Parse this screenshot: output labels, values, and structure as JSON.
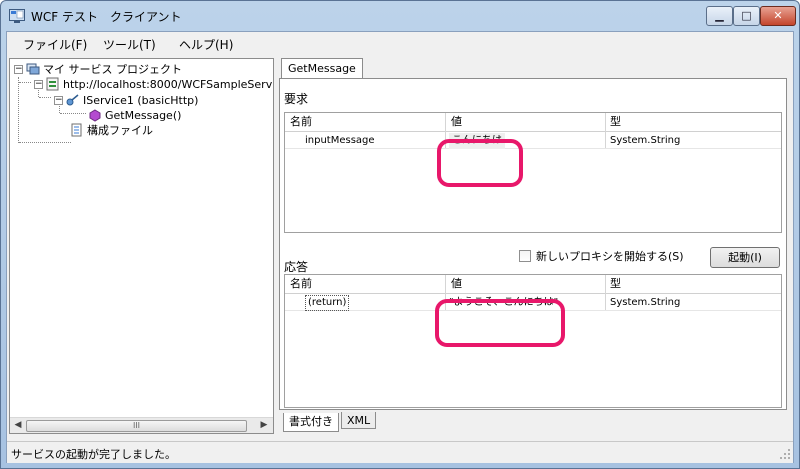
{
  "window": {
    "title": "WCF テスト　クライアント",
    "controls": {
      "minimize": "▁",
      "maximize": "□",
      "close": "✕"
    }
  },
  "menu": [
    {
      "label": "ファイル(F)"
    },
    {
      "label": "ツール(T)"
    },
    {
      "label": "ヘルプ(H)"
    }
  ],
  "tree": {
    "root": "マイ サービス プロジェクト",
    "endpoint": "http://localhost:8000/WCFSampleServ",
    "contract": "IService1 (basicHttp)",
    "operation": "GetMessage()",
    "config": "構成ファイル",
    "expand_root": "−",
    "expand_endpoint": "−",
    "expand_contract": "−",
    "scroll_thumb_grip": "III",
    "scroll_left": "◀",
    "scroll_right": "▶"
  },
  "main_tab": {
    "label": "GetMessage"
  },
  "request": {
    "section_label": "要求",
    "columns": [
      "名前",
      "値",
      "型"
    ],
    "rows": [
      {
        "name": "inputMessage",
        "value": "こんにちは",
        "type": "System.String"
      }
    ]
  },
  "response": {
    "section_label": "応答",
    "new_proxy_label": "新しいプロキシを開始する(S)",
    "new_proxy_checked": false,
    "invoke_label": "起動(I)",
    "columns": [
      "名前",
      "値",
      "型"
    ],
    "rows": [
      {
        "name": "(return)",
        "value": "\"ようこそ、こんにちは\"",
        "type": "System.String"
      }
    ]
  },
  "bottom_tabs": [
    {
      "label": "書式付き",
      "active": true
    },
    {
      "label": "XML",
      "active": false
    }
  ],
  "status": {
    "text": "サービスの起動が完了しました。"
  },
  "colors": {
    "highlight": "#e8176a"
  }
}
